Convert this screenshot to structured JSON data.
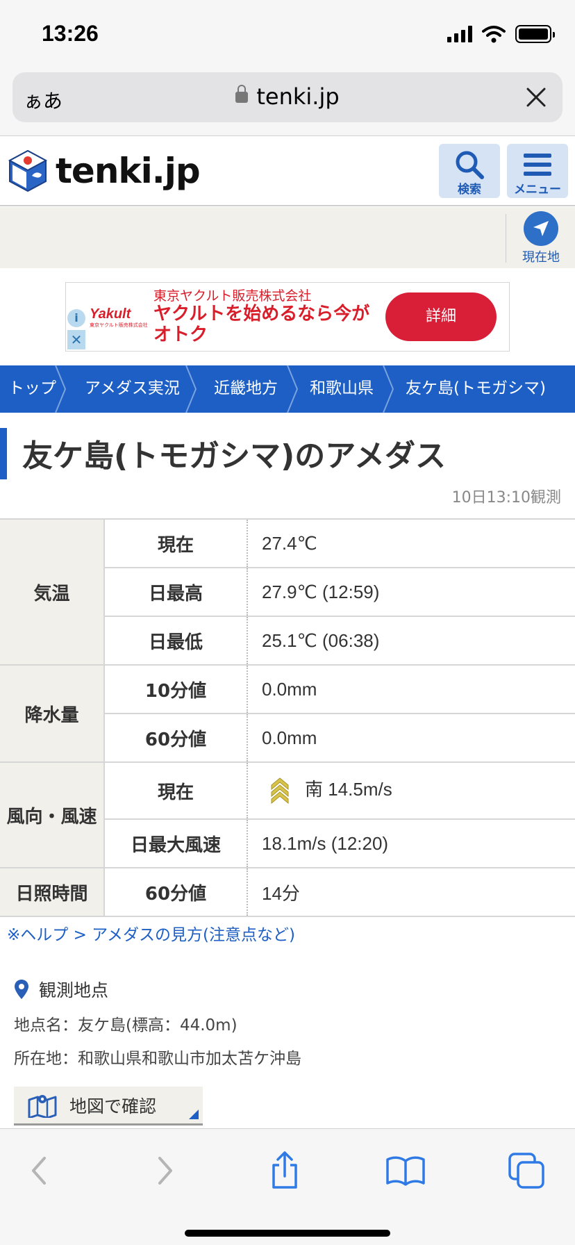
{
  "status_bar": {
    "time": "13:26"
  },
  "address_bar": {
    "aa_label": "ぁあ",
    "url": "tenki.jp"
  },
  "site_header": {
    "logo_text": "tenki.jp",
    "search_label": "検索",
    "menu_label": "メニュー"
  },
  "location": {
    "current_location_label": "現在地"
  },
  "ad": {
    "brand": "Yakult",
    "brand_sub": "東京ヤクルト販売株式会社",
    "company": "東京ヤクルト販売株式会社",
    "copy": "ヤクルトを始めるなら今がオトク",
    "button_label": "詳細"
  },
  "breadcrumb": {
    "items": [
      "トップ",
      "アメダス実況",
      "近畿地方",
      "和歌山県",
      "友ケ島(トモガシマ)"
    ]
  },
  "page": {
    "title": "友ケ島(トモガシマ)のアメダス",
    "observed_at": "10日13:10観測"
  },
  "amedas": {
    "temperature": {
      "label": "気温",
      "current_label": "現在",
      "current_value": "27.4℃",
      "max_label": "日最高",
      "max_value": "27.9℃ (12:59)",
      "min_label": "日最低",
      "min_value": "25.1℃ (06:38)"
    },
    "precipitation": {
      "label": "降水量",
      "ten_min_label": "10分値",
      "ten_min_value": "0.0mm",
      "sixty_min_label": "60分値",
      "sixty_min_value": "0.0mm"
    },
    "wind": {
      "label": "風向・風速",
      "current_label": "現在",
      "current_value": "南 14.5m/s",
      "max_label": "日最大風速",
      "max_value": "18.1m/s (12:20)",
      "arrow_icon": "wind-direction-south-icon",
      "arrow_color": "#d8c34a"
    },
    "sunshine": {
      "label": "日照時間",
      "sixty_min_label": "60分値",
      "sixty_min_value": "14分"
    }
  },
  "help_link": "※ヘルプ > アメダスの見方(注意点など)",
  "station": {
    "heading": "観測地点",
    "name_line": "地点名：友ケ島(標高：44.0m)",
    "address_line": "所在地：和歌山県和歌山市加太苫ケ沖島",
    "map_button_label": "地図で確認"
  },
  "colors": {
    "brand_blue": "#1d5fc4",
    "ad_red": "#d91f37",
    "category_bg": "#f1f0ea"
  }
}
